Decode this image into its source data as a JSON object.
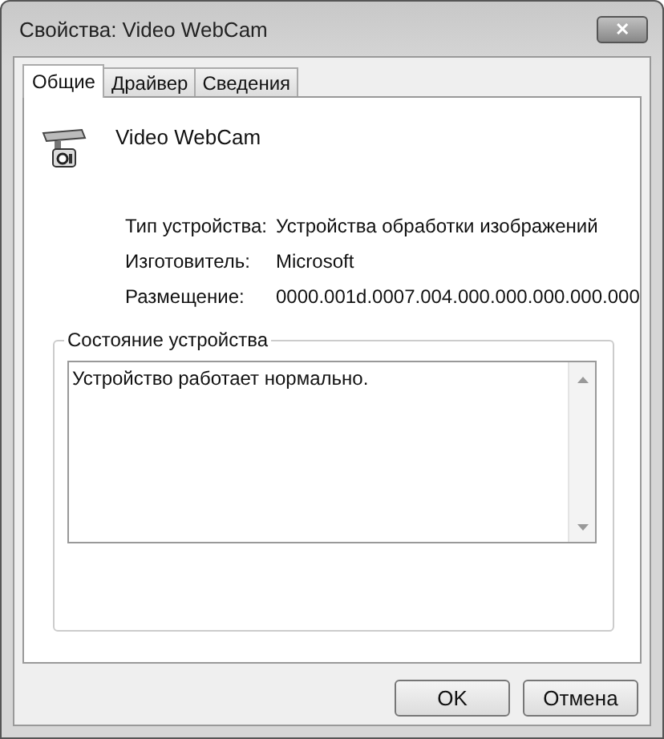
{
  "window": {
    "title": "Свойства: Video WebCam",
    "close": "✕"
  },
  "tabs": [
    {
      "label": "Общие",
      "selected": true
    },
    {
      "label": "Драйвер",
      "selected": false
    },
    {
      "label": "Сведения",
      "selected": false
    }
  ],
  "device": {
    "name": "Video WebCam"
  },
  "properties": [
    {
      "label": "Тип устройства:",
      "value": "Устройства обработки изображений"
    },
    {
      "label": "Изготовитель:",
      "value": "Microsoft"
    },
    {
      "label": "Размещение:",
      "value": "0000.001d.0007.004.000.000.000.000.000"
    }
  ],
  "status": {
    "title": "Состояние устройства",
    "text": "Устройство работает нормально."
  },
  "buttons": [
    "OK",
    "Отмена"
  ]
}
